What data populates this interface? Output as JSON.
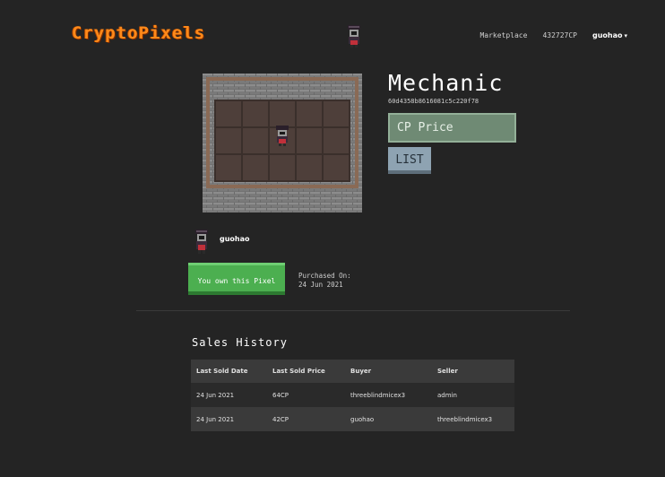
{
  "header": {
    "logo": "CryptoPixels",
    "nav": {
      "marketplace": "Marketplace",
      "balance": "432727CP",
      "user": "guohao",
      "caret": "▾"
    }
  },
  "pixel": {
    "name": "Mechanic",
    "hash": "60d4358b8616081c5c220f78",
    "price_placeholder": "CP Price",
    "list_label": "LIST"
  },
  "owner": {
    "name": "guohao",
    "own_label": "You own this Pixel",
    "purchased_label": "Purchased On:",
    "purchased_date": "24 Jun 2021"
  },
  "sales": {
    "title": "Sales History",
    "columns": [
      "Last Sold Date",
      "Last Sold Price",
      "Buyer",
      "Seller"
    ],
    "rows": [
      [
        "24 Jun 2021",
        "64CP",
        "threeblindmicex3",
        "admin"
      ],
      [
        "24 Jun 2021",
        "42CP",
        "guohao",
        "threeblindmicex3"
      ]
    ]
  },
  "colors": {
    "accent": "#ff8a1a",
    "own_green": "#4caf50",
    "price_green": "#6f8a74",
    "list_blue": "#8ea3b2"
  }
}
